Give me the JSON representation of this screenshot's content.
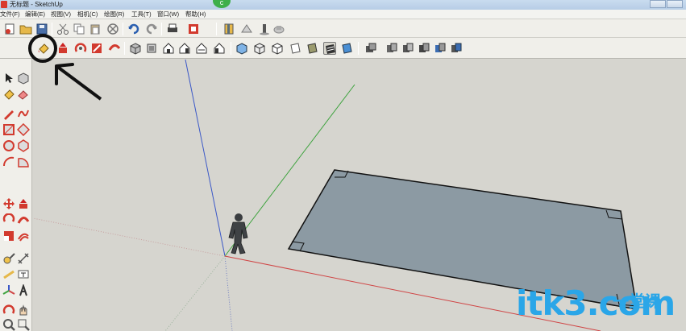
{
  "window": {
    "title": "无标题 - SketchUp",
    "badge": "c"
  },
  "menu": [
    {
      "label": "文件(F)"
    },
    {
      "label": "编辑(E)"
    },
    {
      "label": "视图(V)"
    },
    {
      "label": "相机(C)"
    },
    {
      "label": "绘图(R)"
    },
    {
      "label": "工具(T)"
    },
    {
      "label": "窗口(W)"
    },
    {
      "label": "帮助(H)"
    }
  ],
  "toolbar_top": {
    "icons": [
      "new-file-icon",
      "open-folder-icon",
      "save-icon",
      "cut-icon",
      "copy-icon",
      "paste-icon",
      "erase-icon",
      "undo-icon",
      "redo-icon",
      "print-icon",
      "model-info-icon",
      "section-plane-icon",
      "photo-icon",
      "shadow-icon",
      "warehouse-icon"
    ]
  },
  "toolbar_views": {
    "icons": [
      "paint-bucket-icon",
      "push-pull-icon",
      "orbit-icon",
      "follow-me-icon",
      "outer-shell-icon",
      "iso-view-icon",
      "top-view-icon",
      "front-view-icon",
      "right-view-icon",
      "back-view-icon",
      "left-view-icon",
      "xray-icon",
      "wireframe-icon",
      "hidden-line-icon",
      "shaded-icon",
      "shaded-texture-icon",
      "monochrome-icon",
      "group-icon",
      "component-icon",
      "solid-union-icon",
      "solid-intersect-icon",
      "solid-subtract-icon",
      "solid-trim-icon"
    ],
    "highlighted": "paint-bucket-icon"
  },
  "annotation": {
    "circle_color": "#111111",
    "arrow_color": "#111111"
  },
  "scene": {
    "axis_colors": {
      "blue": "#3a57c7",
      "green": "#3ea33e",
      "red": "#d04545"
    },
    "plane_fill": "#8c9aa3",
    "figure": "person-figure"
  },
  "watermark": {
    "text": "itk3.com",
    "sub": "一堂课"
  }
}
